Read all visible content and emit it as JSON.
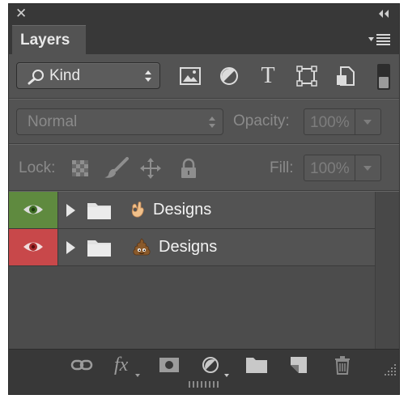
{
  "panel": {
    "close_glyph": "✕",
    "tab_label": "Layers"
  },
  "filter": {
    "kind_label": "Kind",
    "icons": [
      "pixel-layer-filter-icon",
      "adjustment-layer-filter-icon",
      "type-layer-filter-icon",
      "shape-layer-filter-icon",
      "smart-object-filter-icon"
    ],
    "type_glyph": "T"
  },
  "blend": {
    "mode": "Normal",
    "opacity_label": "Opacity:",
    "opacity_value": "100%"
  },
  "lock": {
    "label": "Lock:",
    "fill_label": "Fill:",
    "fill_value": "100%"
  },
  "layers": [
    {
      "name": "Designs",
      "emoji": "ok-hand-emoji",
      "eye_color": "#5f8a3f"
    },
    {
      "name": "Designs",
      "emoji": "pile-of-poo-emoji",
      "eye_color": "#c8484a"
    }
  ],
  "footer": {
    "fx_label": "fx",
    "icons": [
      "link-layers-icon",
      "layer-style-fx-icon",
      "add-mask-icon",
      "new-adjustment-layer-icon",
      "new-group-icon",
      "new-layer-icon",
      "delete-layer-icon"
    ]
  }
}
